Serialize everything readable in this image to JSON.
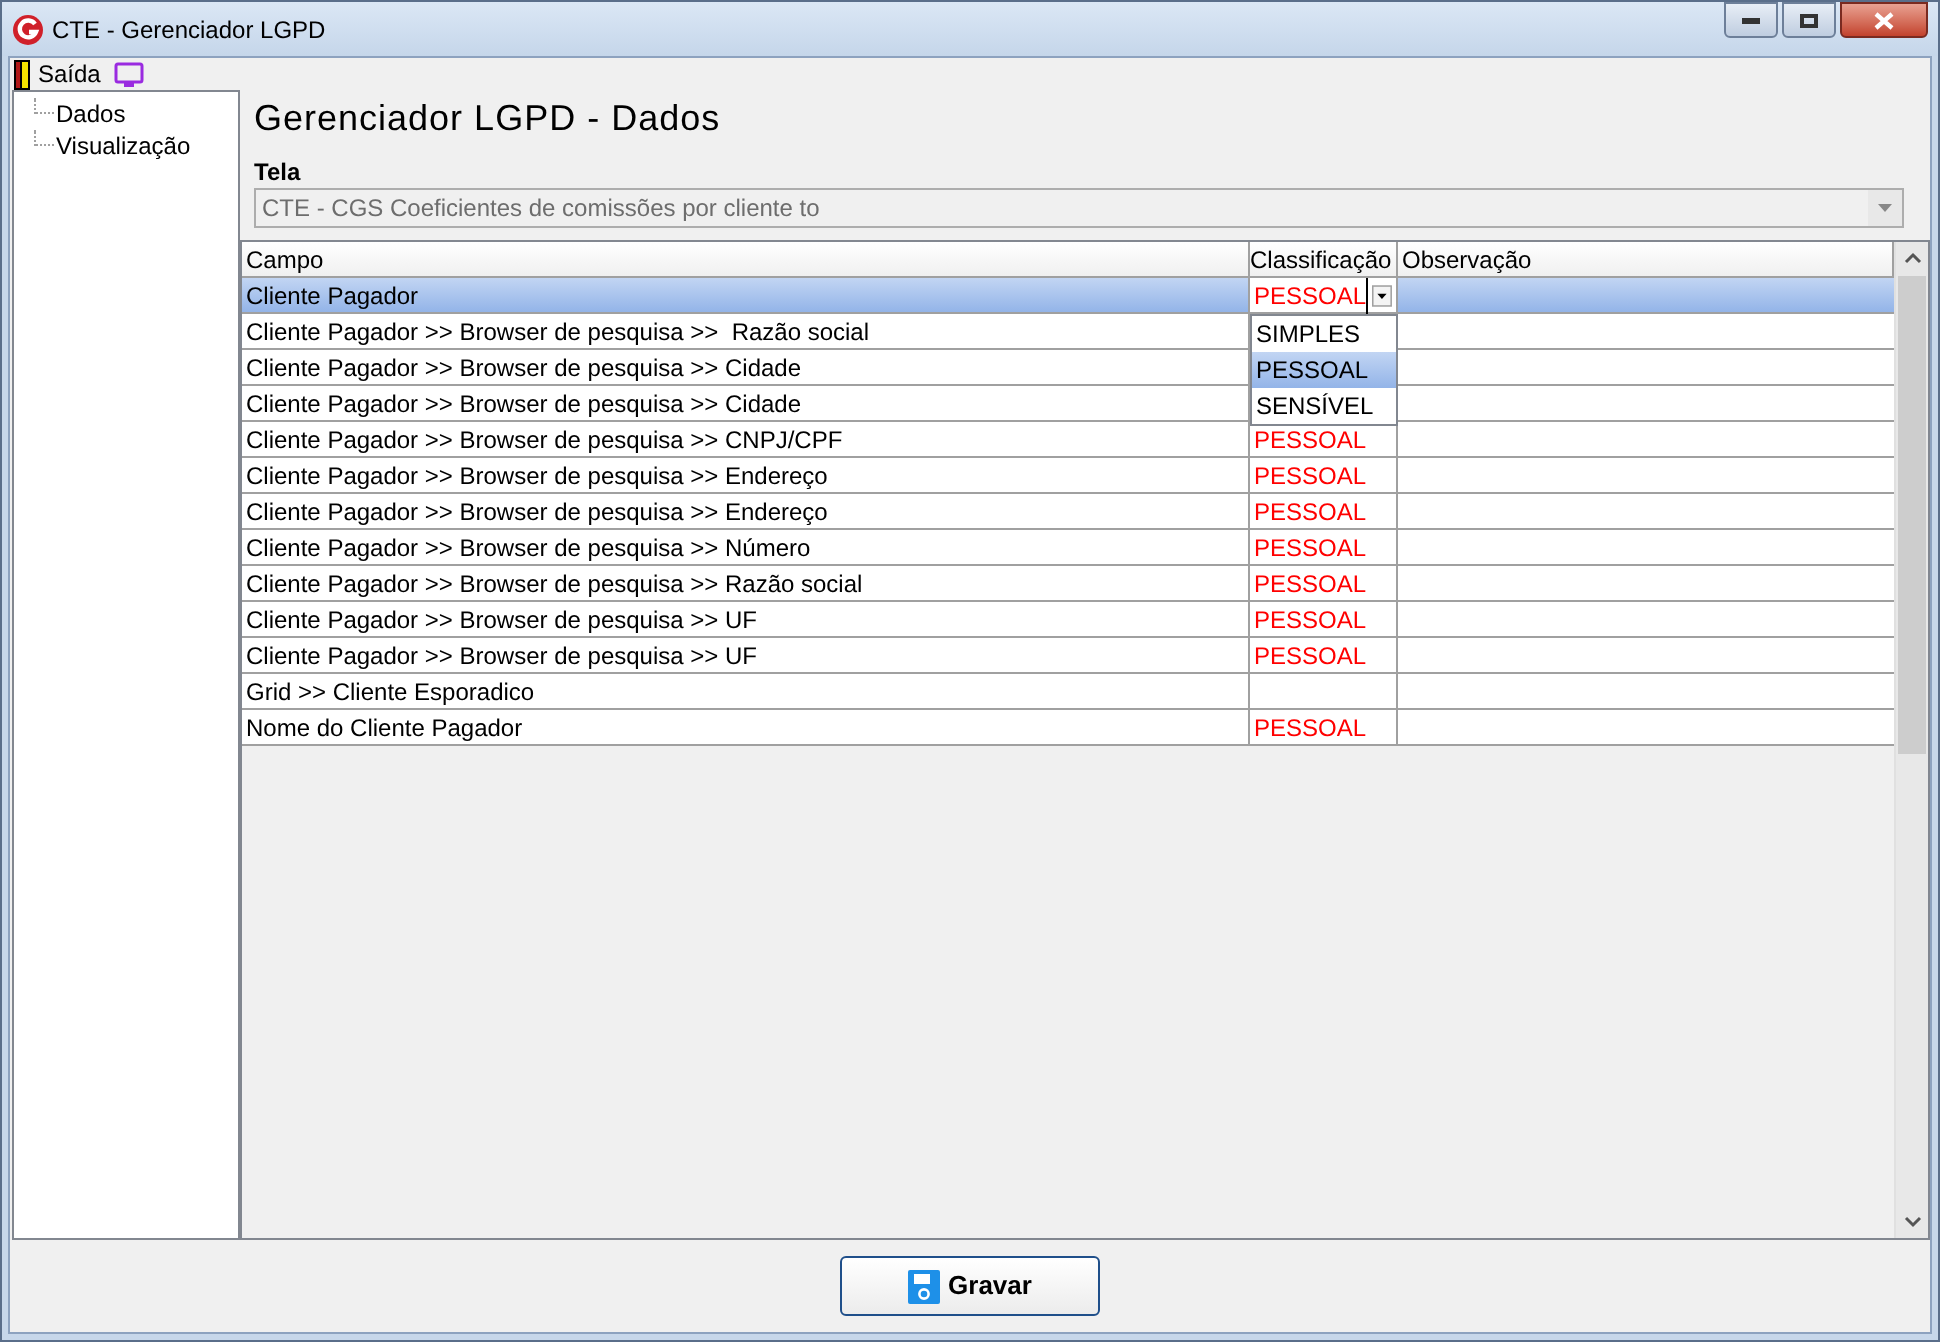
{
  "window": {
    "title": "CTE - Gerenciador LGPD"
  },
  "menu": [
    {
      "label": "Saída",
      "kind": "exit"
    },
    {
      "kind": "monitor"
    }
  ],
  "tree": [
    {
      "label": "Dados",
      "selected": false
    },
    {
      "label": "Visualização",
      "selected": false
    }
  ],
  "heading": "Gerenciador LGPD - Dados",
  "tela": {
    "label": "Tela",
    "value": "CTE - CGS Coeficientes de comissões por cliente to"
  },
  "table": {
    "columns": [
      "Campo",
      "Classificação",
      "Observação"
    ],
    "rows": [
      {
        "campo": "Cliente Pagador",
        "classificacao": "PESSOAL",
        "selected": true
      },
      {
        "campo": "Cliente Pagador >> Browser de pesquisa >>  Razão social",
        "selected": false
      },
      {
        "campo": "Cliente Pagador >> Browser de pesquisa >> Cidade",
        "selected": false
      },
      {
        "campo": "Cliente Pagador >> Browser de pesquisa >> Cidade",
        "selected": false
      },
      {
        "campo": "Cliente Pagador >> Browser de pesquisa >> CNPJ/CPF",
        "classificacao": "PESSOAL",
        "selected": false
      },
      {
        "campo": "Cliente Pagador >> Browser de pesquisa >> Endereço",
        "classificacao": "PESSOAL",
        "selected": false
      },
      {
        "campo": "Cliente Pagador >> Browser de pesquisa >> Endereço",
        "classificacao": "PESSOAL",
        "selected": false
      },
      {
        "campo": "Cliente Pagador >> Browser de pesquisa >> Número",
        "classificacao": "PESSOAL",
        "selected": false
      },
      {
        "campo": "Cliente Pagador >> Browser de pesquisa >> Razão social",
        "classificacao": "PESSOAL",
        "selected": false
      },
      {
        "campo": "Cliente Pagador >> Browser de pesquisa >> UF",
        "classificacao": "PESSOAL",
        "selected": false
      },
      {
        "campo": "Cliente Pagador >> Browser de pesquisa >> UF",
        "classificacao": "PESSOAL",
        "selected": false
      },
      {
        "campo": "Grid >> Cliente Esporadico",
        "selected": false
      },
      {
        "campo": "Nome do Cliente Pagador",
        "classificacao": "PESSOAL",
        "selected": false
      }
    ],
    "dropdown": {
      "open": true,
      "options": [
        {
          "label": "SIMPLES",
          "selected": false
        },
        {
          "label": "PESSOAL",
          "selected": true
        },
        {
          "label": "SENSÍVEL",
          "selected": false
        }
      ]
    }
  },
  "save_button": {
    "label": "Gravar"
  }
}
